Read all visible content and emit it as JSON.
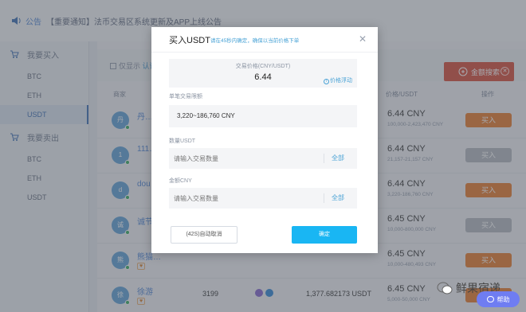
{
  "notice": {
    "label": "公告",
    "text": "【重要通知】法币交易区系统更新及APP上线公告"
  },
  "sidebar": {
    "buy_title": "我要买入",
    "buy_items": [
      "BTC",
      "ETH",
      "USDT"
    ],
    "sell_title": "我要卖出",
    "sell_items": [
      "BTC",
      "ETH",
      "USDT"
    ]
  },
  "filter": {
    "checkbox_label": "仅显示",
    "checkbox_highlight": "认证",
    "search_label": "金额搜索"
  },
  "table": {
    "headers": {
      "merchant": "商家",
      "price": "价格/USDT",
      "action": "操作"
    },
    "rows": [
      {
        "avatar": "丹",
        "name": "丹…",
        "count": "",
        "amount": "",
        "price": "6.44 CNY",
        "limit": "100,000-2,423,470 CNY",
        "action": "买入",
        "disabled": false
      },
      {
        "avatar": "1",
        "name": "111…",
        "count": "",
        "amount": "",
        "price": "6.44 CNY",
        "limit": "21,157-21,157 CNY",
        "action": "买入",
        "disabled": true
      },
      {
        "avatar": "d",
        "name": "dou…",
        "count": "",
        "amount": "",
        "price": "6.44 CNY",
        "limit": "3,220-186,760 CNY",
        "action": "买入",
        "disabled": false
      },
      {
        "avatar": "诚",
        "name": "诚节…",
        "count": "",
        "amount": "",
        "price": "6.45 CNY",
        "limit": "10,000-800,000 CNY",
        "action": "买入",
        "disabled": true
      },
      {
        "avatar": "熊",
        "name": "熊猫…",
        "count": "",
        "amount": "",
        "price": "6.45 CNY",
        "limit": "10,000-480,493 CNY",
        "action": "买入",
        "disabled": false
      },
      {
        "avatar": "徐",
        "name": "徐游",
        "count": "3199",
        "amount": "1,377.682173 USDT",
        "price": "6.45 CNY",
        "limit": "5,000-50,000 CNY",
        "action": "买入",
        "disabled": false
      }
    ]
  },
  "modal": {
    "title": "买入USDT",
    "subtitle": "请在45秒内确定，确保以当前价格下单",
    "price_label": "交易价格(CNY/USDT)",
    "price_value": "6.44",
    "float_label": "价格浮动",
    "limit_label": "单笔交易限额",
    "limit_value": "3,220~186,760 CNY",
    "qty_label": "数量USDT",
    "qty_placeholder": "请输入交易数量",
    "amount_label": "金额CNY",
    "amount_placeholder": "请输入交易数量",
    "all_label": "全部",
    "cancel_label": "(42S)自动取消",
    "confirm_label": "确定"
  },
  "watermark": "鲜果宿递",
  "help_label": "帮助",
  "colors": {
    "primary": "#19b6f3",
    "action": "#e8843b",
    "search": "#d75a48",
    "help": "#6f7df2"
  }
}
